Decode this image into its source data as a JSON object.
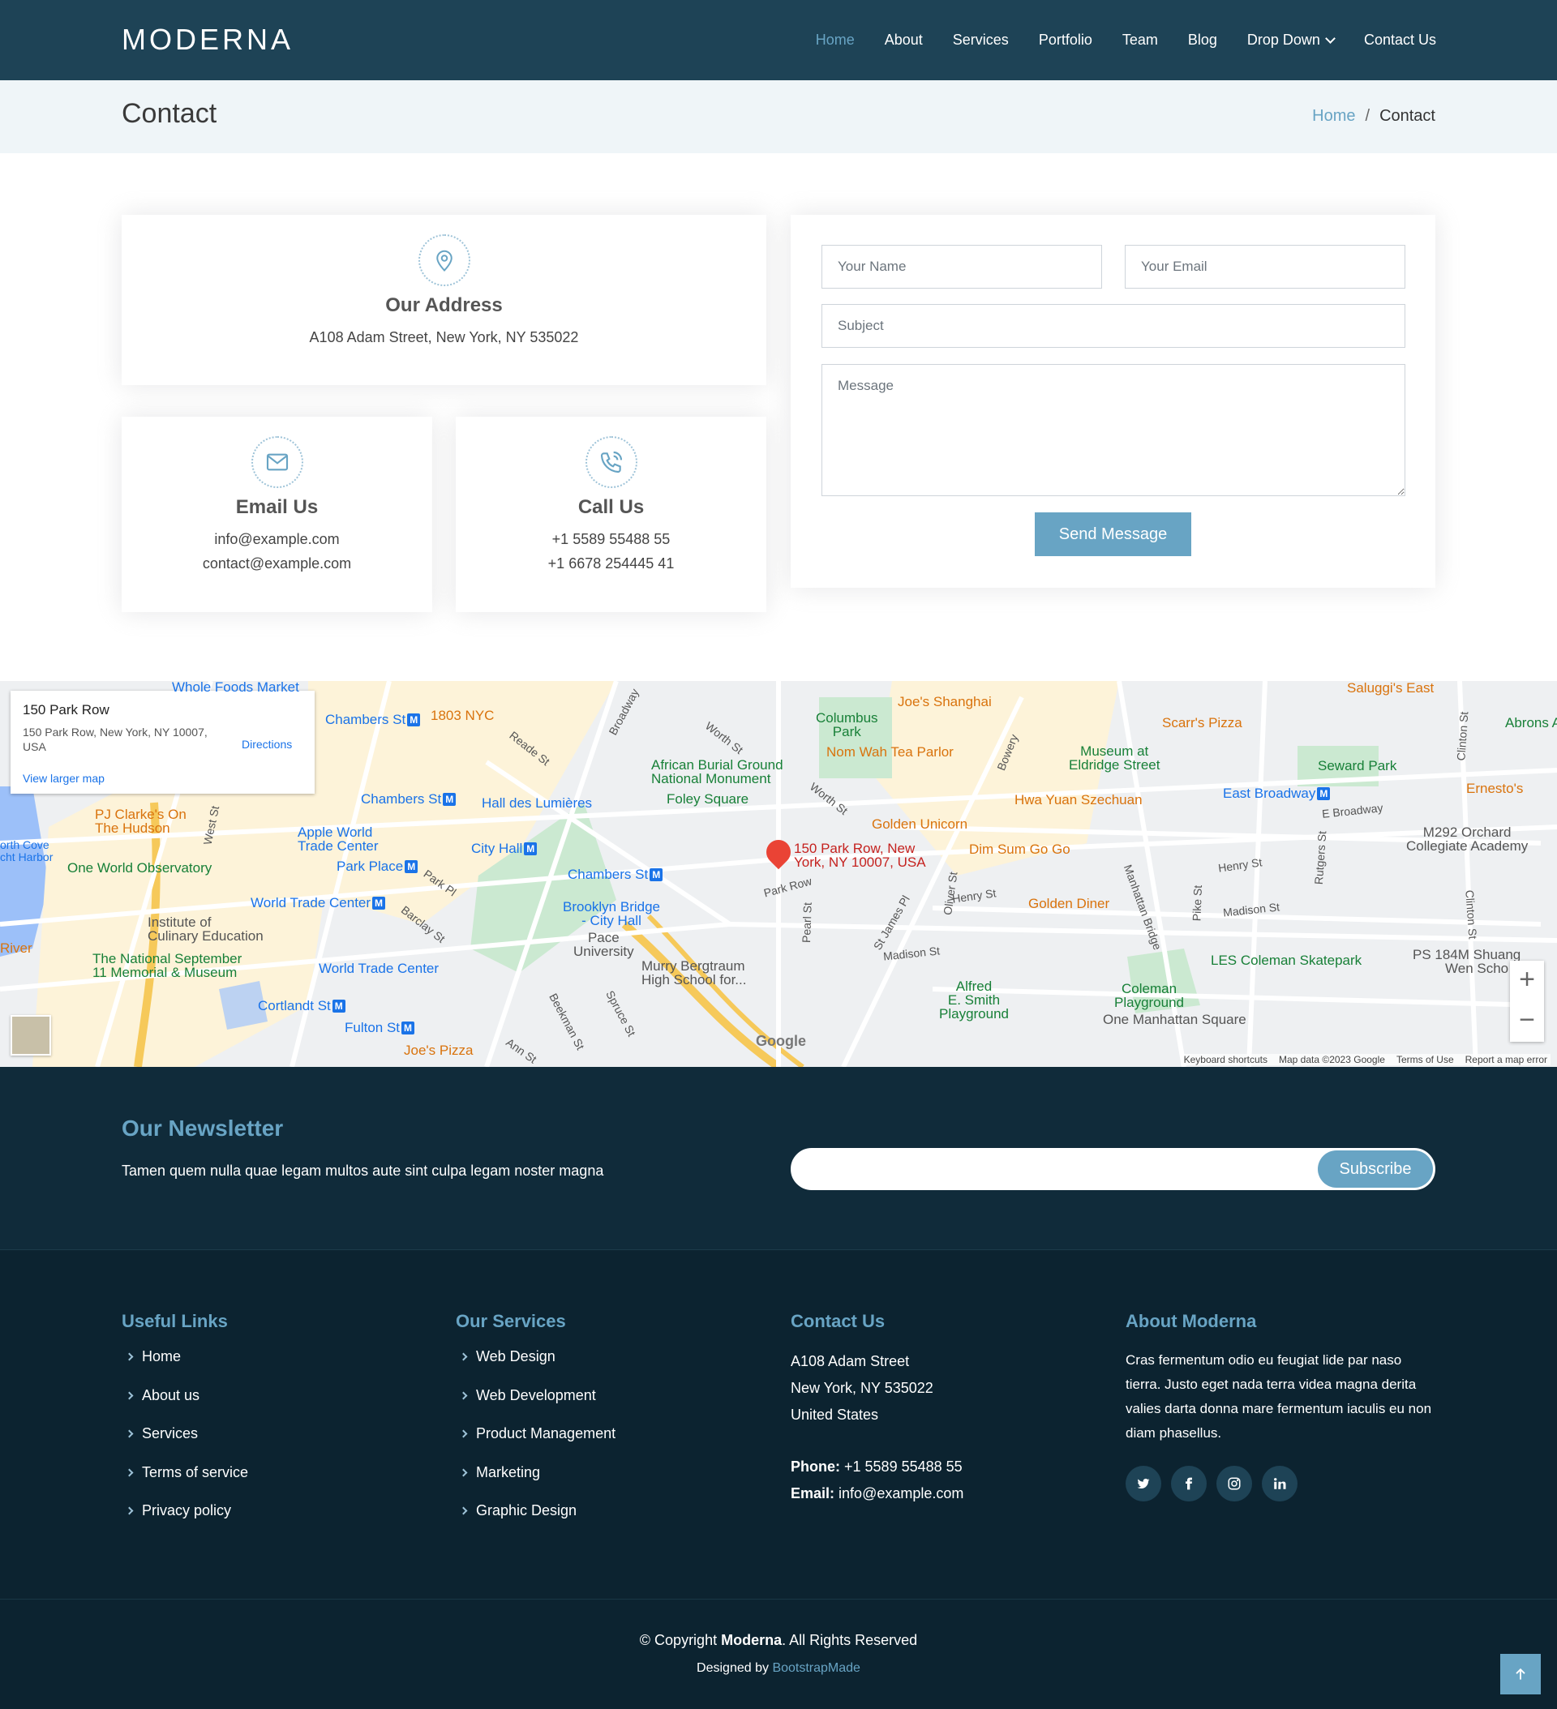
{
  "header": {
    "logo": "MODERNA",
    "nav": [
      "Home",
      "About",
      "Services",
      "Portfolio",
      "Team",
      "Blog",
      "Drop Down",
      "Contact Us"
    ],
    "active": "Home"
  },
  "breadcrumb": {
    "title": "Contact",
    "home": "Home",
    "sep": "/",
    "current": "Contact"
  },
  "info": {
    "address": {
      "title": "Our Address",
      "line": "A108 Adam Street, New York, NY 535022"
    },
    "email": {
      "title": "Email Us",
      "line1": "info@example.com",
      "line2": "contact@example.com"
    },
    "call": {
      "title": "Call Us",
      "line1": "+1 5589 55488 55",
      "line2": "+1 6678 254445 41"
    }
  },
  "form": {
    "name_placeholder": "Your Name",
    "email_placeholder": "Your Email",
    "subject_placeholder": "Subject",
    "message_placeholder": "Message",
    "send_label": "Send Message"
  },
  "map": {
    "card": {
      "title": "150 Park Row",
      "address": "150 Park Row, New York, NY 10007, USA",
      "directions": "Directions",
      "larger": "View larger map"
    },
    "pin_label_1": "150 Park Row, New",
    "pin_label_2": "York, NY 10007, USA",
    "places": {
      "wholefoods": "Whole Foods Market",
      "chambers1": "Chambers St",
      "nyc1803": "1803 NYC",
      "joes_shanghai": "Joe's Shanghai",
      "saluggis": "Saluggi's East",
      "abrons": "Abrons A",
      "scarrs": "Scarr's Pizza",
      "columbus": "Columbus",
      "columbus2": "Park",
      "nomwah": "Nom Wah Tea Parlor",
      "museum1": "Museum at",
      "museum2": "Eldridge Street",
      "seward": "Seward Park",
      "african1": "African Burial Ground",
      "african2": "National Monument",
      "foley": "Foley Square",
      "chambers2": "Chambers St",
      "hall": "Hall des Lumières",
      "hwa": "Hwa Yuan Szechuan",
      "eastbroadway": "East Broadway",
      "ernestos": "Ernesto's",
      "pj1": "PJ Clarke's On",
      "pj2": "The Hudson",
      "apple1": "Apple World",
      "apple2": "Trade Center",
      "cityhall": "City Hall",
      "golden_unicorn": "Golden Unicorn",
      "dimsum": "Dim Sum Go Go",
      "m292a": "M292 Orchard",
      "m292b": "Collegiate Academy",
      "northcove1": "orth Cove",
      "northcove2": "cht Harbor",
      "oneworld": "One World Observatory",
      "parkplace": "Park Place",
      "chambers3": "Chambers St",
      "wtc1": "World Trade Center",
      "bridge1": "Brooklyn Bridge",
      "bridge2": "- City Hall",
      "golden_diner": "Golden Diner",
      "institute1": "Institute of",
      "institute2": "Culinary Education",
      "pace1": "Pace",
      "pace2": "University",
      "river": "River",
      "sept1": "The National September",
      "sept2": "11 Memorial & Museum",
      "wtc2": "World Trade Center",
      "murry1": "Murry Bergtraum",
      "murry2": "High School for...",
      "les": "LES Coleman Skatepark",
      "ps184a": "PS 184M Shuang",
      "ps184b": "Wen Scho",
      "cortlandt": "Cortlandt St",
      "alfred1": "Alfred",
      "alfred2": "E. Smith",
      "alfred3": "Playground",
      "coleman1": "Coleman",
      "coleman2": "Playground",
      "onemanhattan": "One Manhattan Square",
      "fulton": "Fulton St",
      "joes_pizza": "Joe's Pizza"
    },
    "streets": {
      "broadway": "Broadway",
      "worth1": "Worth St",
      "reade": "Reade St",
      "westst": "West St",
      "bowery": "Bowery",
      "worth2": "Worth St",
      "parkpl": "Park Pl",
      "barclay": "Barclay St",
      "parkrow": "Park Row",
      "pearl": "Pearl St",
      "stjames": "St James Pl",
      "oliver": "Oliver St",
      "henry1": "Henry St",
      "henry2": "Henry St",
      "madison1": "Madison St",
      "madison2": "Madison St",
      "manhattanbridge": "Manhattan Bridge",
      "pike": "Pike St",
      "rutgers": "Rutgers St",
      "ebroadway": "E Broadway",
      "clinton1": "Clinton St",
      "clinton2": "Clinton St",
      "beekman": "Beekman St",
      "spruce": "Spruce St",
      "ann": "Ann St"
    },
    "badge": "M",
    "google": "Google",
    "footer": [
      "Keyboard shortcuts",
      "Map data ©2023 Google",
      "Terms of Use",
      "Report a map error"
    ]
  },
  "newsletter": {
    "title": "Our Newsletter",
    "text": "Tamen quem nulla quae legam multos aute sint culpa legam noster magna",
    "subscribe": "Subscribe"
  },
  "footer": {
    "useful": {
      "title": "Useful Links",
      "items": [
        "Home",
        "About us",
        "Services",
        "Terms of service",
        "Privacy policy"
      ]
    },
    "services": {
      "title": "Our Services",
      "items": [
        "Web Design",
        "Web Development",
        "Product Management",
        "Marketing",
        "Graphic Design"
      ]
    },
    "contact": {
      "title": "Contact Us",
      "line1": "A108 Adam Street",
      "line2": "New York, NY 535022",
      "line3": "United States",
      "phone_label": "Phone:",
      "phone": "+1 5589 55488 55",
      "email_label": "Email:",
      "email": "info@example.com"
    },
    "about": {
      "title": "About Moderna",
      "text": "Cras fermentum odio eu feugiat lide par naso tierra. Justo eget nada terra videa magna derita valies darta donna mare fermentum iaculis eu non diam phasellus."
    },
    "copyright_prefix": "© Copyright",
    "copyright_brand": "Moderna",
    "copyright_suffix": ". All Rights Reserved",
    "designed_prefix": "Designed by",
    "designed_link": "BootstrapMade"
  },
  "colors": {
    "header": "#1e4356",
    "accent": "#68a4c4",
    "footer": "#0c2330",
    "newsletter": "#102b3a"
  }
}
